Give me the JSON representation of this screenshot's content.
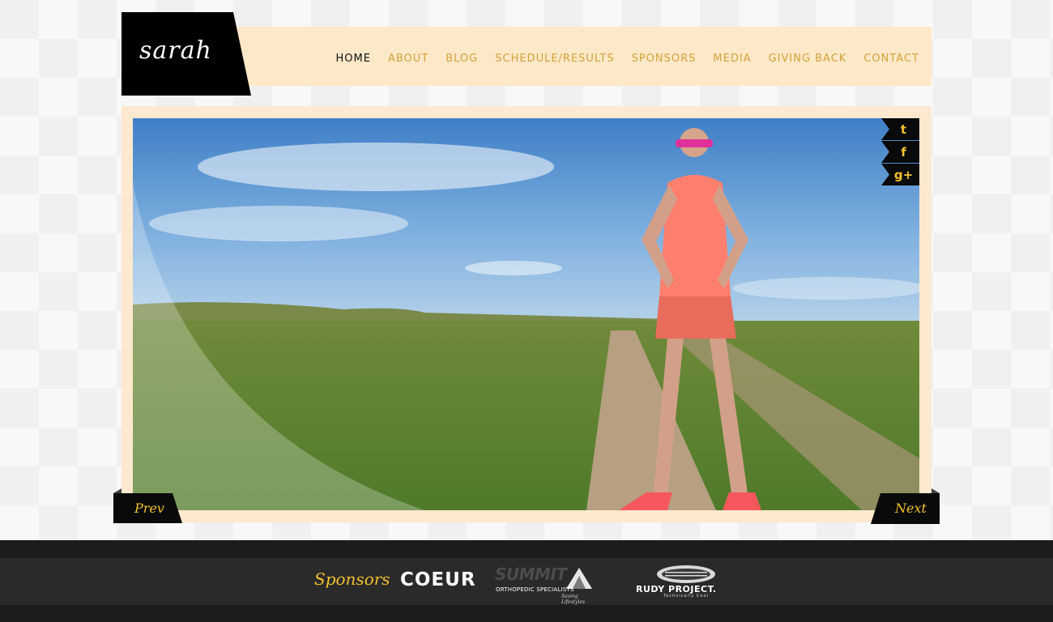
{
  "brand": {
    "logo_text": "sarah"
  },
  "nav": {
    "items": [
      {
        "label": "HOME",
        "active": true
      },
      {
        "label": "ABOUT"
      },
      {
        "label": "BLOG"
      },
      {
        "label": "SCHEDULE/RESULTS"
      },
      {
        "label": "SPONSORS"
      },
      {
        "label": "MEDIA"
      },
      {
        "label": "GIVING BACK"
      },
      {
        "label": "CONTACT"
      }
    ]
  },
  "slider": {
    "prev_label": "Prev",
    "next_label": "Next"
  },
  "social": {
    "twitter_icon": "twitter-icon",
    "facebook_icon": "facebook-icon",
    "googleplus_icon": "google-plus-icon",
    "twitter_glyph": "t",
    "facebook_glyph": "f",
    "googleplus_glyph": "g+"
  },
  "footer": {
    "sponsors_label": "Sponsors",
    "sponsor_logos": {
      "coeur": "COEUR",
      "summit_word": "SUMMIT",
      "summit_sub": "ORTHOPEDIC SPECIALISTS",
      "summit_tag": "Saving Lifestyles",
      "rudy_word": "RUDY PROJECT.",
      "rudy_tag": "Technically Cool"
    }
  },
  "colors": {
    "accent": "#d4a338",
    "panel": "#fde8c8",
    "logo_bg": "#000000",
    "footer_bg": "#1c1c1c",
    "button_text": "#f2c030"
  }
}
